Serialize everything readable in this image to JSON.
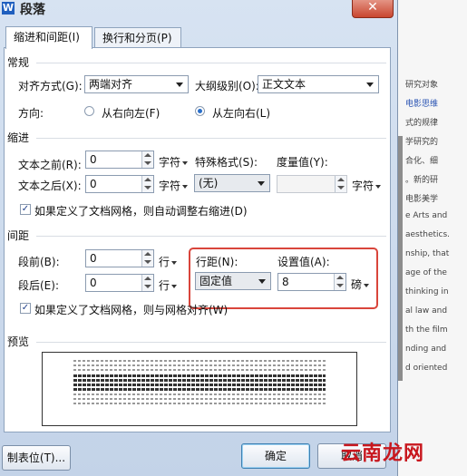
{
  "window": {
    "title": "段落",
    "icon": "W",
    "close_glyph": "✕"
  },
  "tabs": [
    {
      "label": "缩进和间距(I)",
      "active": true
    },
    {
      "label": "换行和分页(P)",
      "active": false
    }
  ],
  "general": {
    "heading": "常规",
    "alignment_label": "对齐方式(G):",
    "alignment_value": "两端对齐",
    "outline_label": "大纲级别(O):",
    "outline_value": "正文文本",
    "direction_label": "方向:",
    "rtl_label": "从右向左(F)",
    "ltr_label": "从左向右(L)",
    "selected_direction": "ltr"
  },
  "indent": {
    "heading": "缩进",
    "before_label": "文本之前(R):",
    "before_value": "0",
    "before_unit": "字符",
    "after_label": "文本之后(X):",
    "after_value": "0",
    "after_unit": "字符",
    "special_label": "特殊格式(S):",
    "special_value": "(无)",
    "measure_label": "度量值(Y):",
    "measure_value": "",
    "measure_unit": "字符",
    "auto_adjust_label": "如果定义了文档网格，则自动调整右缩进(D)",
    "auto_adjust_checked": true
  },
  "spacing": {
    "heading": "间距",
    "before_label": "段前(B):",
    "before_value": "0",
    "before_unit": "行",
    "after_label": "段后(E):",
    "after_value": "0",
    "after_unit": "行",
    "line_label": "行距(N):",
    "line_value": "固定值",
    "setting_label": "设置值(A):",
    "setting_value": "8",
    "setting_unit": "磅",
    "snap_grid_label": "如果定义了文档网格，则与网格对齐(W)",
    "snap_grid_checked": true
  },
  "preview": {
    "heading": "预览"
  },
  "buttons": {
    "tabs": "制表位(T)...",
    "ok": "确定",
    "cancel": "取消"
  },
  "background_text": [
    {
      "text": "研究对象",
      "blue": false
    },
    {
      "text": "电影思维",
      "blue": true
    },
    {
      "text": "式的规律",
      "blue": false
    },
    {
      "text": "学研究的",
      "blue": false
    },
    {
      "text": "合化、细",
      "blue": false
    },
    {
      "text": "。新的研",
      "blue": false
    },
    {
      "text": "电影美学",
      "blue": false
    },
    {
      "text": "e Arts and",
      "blue": false
    },
    {
      "text": "aesthetics.",
      "blue": false
    },
    {
      "text": "nship, that",
      "blue": false
    },
    {
      "text": "age of the",
      "blue": false
    },
    {
      "text": "thinking in",
      "blue": false
    },
    {
      "text": "al law and",
      "blue": false
    },
    {
      "text": "th the film",
      "blue": false
    },
    {
      "text": "nding  and",
      "blue": false
    },
    {
      "text": "d oriented",
      "blue": false
    }
  ],
  "watermark": "云南龙网",
  "colors": {
    "highlight_box": "#d9453b",
    "accent": "#2a6fc9"
  }
}
